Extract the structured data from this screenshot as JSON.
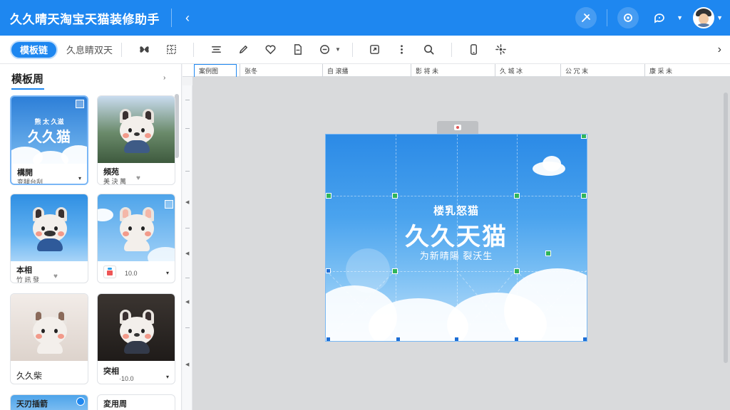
{
  "app": {
    "title": "久久晴天淘宝天猫装修助手"
  },
  "topbar": {
    "back_icon": "‹"
  },
  "toolbar": {
    "primary_label": "模板链",
    "secondary_label": "久息睛双天",
    "end_icon": "›"
  },
  "ruler": {
    "cells": [
      "案例图",
      "张冬",
      "自 滚播",
      "影 将 未",
      "久 城 冰",
      "公 冗 末",
      "康 采 未"
    ]
  },
  "left_panel": {
    "title": "模板周",
    "arrow": "›",
    "cards": [
      {
        "thumb_text_top": "熊 太 久滋",
        "thumb_text_main": "久久猫",
        "title": "構開",
        "sub": "变腿台刮",
        "caret": "▾"
      },
      {
        "title": "頻苑",
        "sub": "美 決 萬",
        "heart": "♥"
      },
      {
        "title": "本相",
        "sub": "竹 訊 發",
        "heart": "♥"
      },
      {
        "sub": "10.0",
        "caret": "▾"
      },
      {
        "title": "久久柴"
      },
      {
        "title": "突相",
        "sub": "·10.0",
        "caret": "▾"
      },
      {
        "title": "天刃插箭"
      },
      {
        "title": "変用周"
      }
    ]
  },
  "canvas": {
    "banner": {
      "subtitle": "楼乳怒猫",
      "title": "久久天猫",
      "tagline": "为新晴陽 裂沃生"
    }
  },
  "colors": {
    "accent": "#1e87f0",
    "handle_green": "#2fb45a"
  }
}
